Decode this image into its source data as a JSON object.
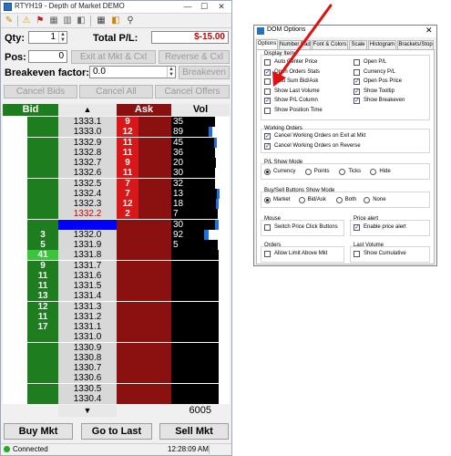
{
  "window": {
    "title": "RTYH19 - Depth of Market DEMO",
    "minimize": "—",
    "maximize": "☐",
    "close": "✕"
  },
  "toolbar": {
    "icons": [
      "pencil-icon",
      "warning-icon",
      "flag-icon",
      "ruler-icon",
      "grid-icon",
      "palette-icon",
      "pin-icon"
    ],
    "glyphs": [
      "✎",
      "⚠",
      "⚑",
      "▦",
      "▥",
      "◧",
      "⚲"
    ]
  },
  "controls": {
    "qty_label": "Qty:",
    "qty_value": "1",
    "pl_label": "Total P/L:",
    "pl_value": "$-15.00",
    "pos_label": "Pos:",
    "pos_value": "0",
    "exit_button": "Exit at Mkt & Cxl",
    "reverse_button": "Reverse & Cxl",
    "breakeven_factor_label": "Breakeven factor:",
    "breakeven_factor_value": "0.0",
    "breakeven_button": "Breakeven",
    "cancel_bids": "Cancel Bids",
    "cancel_all": "Cancel All",
    "cancel_offers": "Cancel Offers"
  },
  "ladder": {
    "headers": {
      "bid": "Bid",
      "price_arrow": "▲",
      "ask": "Ask",
      "vol": "Vol"
    },
    "footer": {
      "price_arrow": "▼",
      "total_vol": "6005"
    },
    "rows": [
      {
        "price": "1333.1",
        "bid": "",
        "ask": "9",
        "vol": "35",
        "volpct": 0.92,
        "blue": 0
      },
      {
        "price": "1333.0",
        "bid": "",
        "ask": "12",
        "vol": "89",
        "volpct": 0.78,
        "blue": 0.06
      },
      {
        "price": "1332.9",
        "bid": "",
        "ask": "11",
        "vol": "45",
        "volpct": 0.9,
        "blue": 0.03
      },
      {
        "price": "1332.8",
        "bid": "",
        "ask": "11",
        "vol": "36",
        "volpct": 0.92,
        "blue": 0
      },
      {
        "price": "1332.7",
        "bid": "",
        "ask": "9",
        "vol": "20",
        "volpct": 0.94,
        "blue": 0
      },
      {
        "price": "1332.6",
        "bid": "",
        "ask": "11",
        "vol": "30",
        "volpct": 0.92,
        "blue": 0
      },
      {
        "price": "1332.5",
        "bid": "",
        "ask": "7",
        "vol": "32",
        "volpct": 0.92,
        "blue": 0
      },
      {
        "price": "1332.4",
        "bid": "",
        "ask": "7",
        "vol": "13",
        "volpct": 0.96,
        "blue": 0.04
      },
      {
        "price": "1332.3",
        "bid": "",
        "ask": "12",
        "vol": "18",
        "volpct": 0.95,
        "blue": 0.04
      },
      {
        "price": "1332.2",
        "bid": "",
        "ask": "2",
        "vol": "7",
        "volpct": 0.98,
        "blue": 0,
        "red_price": true
      },
      {
        "price": "",
        "bid": "",
        "ask": "",
        "vol": "30",
        "volpct": 0.93,
        "blue": 0.06,
        "current": true
      },
      {
        "price": "1332.0",
        "bid": "3",
        "ask": "",
        "vol": "92",
        "volpct": 0.7,
        "blue": 0.08
      },
      {
        "price": "1331.9",
        "bid": "5",
        "ask": "",
        "vol": "5",
        "volpct": 0.99,
        "blue": 0
      },
      {
        "price": "1331.8",
        "bid": "41",
        "ask": "",
        "vol": "",
        "volpct": 1,
        "blue": 0,
        "bid_hi": true
      },
      {
        "price": "1331.7",
        "bid": "9",
        "ask": "",
        "vol": "",
        "volpct": 1,
        "blue": 0
      },
      {
        "price": "1331.6",
        "bid": "11",
        "ask": "",
        "vol": "",
        "volpct": 1,
        "blue": 0
      },
      {
        "price": "1331.5",
        "bid": "11",
        "ask": "",
        "vol": "",
        "volpct": 1,
        "blue": 0
      },
      {
        "price": "1331.4",
        "bid": "13",
        "ask": "",
        "vol": "",
        "volpct": 1,
        "blue": 0
      },
      {
        "price": "1331.3",
        "bid": "12",
        "ask": "",
        "vol": "",
        "volpct": 1,
        "blue": 0
      },
      {
        "price": "1331.2",
        "bid": "11",
        "ask": "",
        "vol": "",
        "volpct": 1,
        "blue": 0
      },
      {
        "price": "1331.1",
        "bid": "17",
        "ask": "",
        "vol": "",
        "volpct": 1,
        "blue": 0
      },
      {
        "price": "1331.0",
        "bid": "",
        "ask": "",
        "vol": "",
        "volpct": 1,
        "blue": 0
      },
      {
        "price": "1330.9",
        "bid": "",
        "ask": "",
        "vol": "",
        "volpct": 1,
        "blue": 0
      },
      {
        "price": "1330.8",
        "bid": "",
        "ask": "",
        "vol": "",
        "volpct": 1,
        "blue": 0
      },
      {
        "price": "1330.7",
        "bid": "",
        "ask": "",
        "vol": "",
        "volpct": 1,
        "blue": 0
      },
      {
        "price": "1330.6",
        "bid": "",
        "ask": "",
        "vol": "",
        "volpct": 1,
        "blue": 0
      },
      {
        "price": "1330.5",
        "bid": "",
        "ask": "",
        "vol": "",
        "volpct": 1,
        "blue": 0
      },
      {
        "price": "1330.4",
        "bid": "",
        "ask": "",
        "vol": "",
        "volpct": 1,
        "blue": 0
      }
    ]
  },
  "bottom_buttons": {
    "buy_mkt": "Buy Mkt",
    "go_to_last": "Go to Last",
    "sell_mkt": "Sell Mkt"
  },
  "status": {
    "text": "Connected",
    "time": "12:28:09 AM"
  },
  "colors": {
    "bid_dark": "#1e7d1e",
    "bid_light": "#3cc43c",
    "ask_dark": "#8b1010",
    "ask_cell": "#d81818",
    "price_bg": "#d8d8d8",
    "vol_bar": "#000000",
    "vol_blue": "#1e6fe0",
    "current_bar": "#0000ff",
    "pl_negative": "#cc0000",
    "arrow": "#e01010"
  },
  "options": {
    "title": "DOM Options",
    "tabs": [
      "Options",
      "Number Pad",
      "Font & Colors",
      "Scale",
      "Histogram",
      "Brackets/Stop"
    ],
    "display_items_title": "Display Items",
    "display_items": [
      {
        "label": "Auto Center Price",
        "checked": false
      },
      {
        "label": "Open Orders Stats",
        "checked": true
      },
      {
        "label": "Auto Sum Bid/Ask",
        "checked": false
      },
      {
        "label": "Show Last Volume",
        "checked": false
      },
      {
        "label": "Show P/L Column",
        "checked": true
      },
      {
        "label": "Show Position Time",
        "checked": false
      },
      {
        "label": "Open P/L",
        "checked": false
      },
      {
        "label": "Currency P/L",
        "checked": false
      },
      {
        "label": "Open Pos Price",
        "checked": true
      },
      {
        "label": "Show Tooltip",
        "checked": true
      },
      {
        "label": "Show Breakeven",
        "checked": true
      }
    ],
    "working_orders_title": "Working Orders",
    "working_orders": [
      {
        "label": "Cancel Working Orders on Exit at Mkt",
        "checked": true
      },
      {
        "label": "Cancel Working Orders on Reverse",
        "checked": true
      }
    ],
    "pl_show_mode_title": "P/L Show Mode",
    "pl_show_mode": [
      {
        "label": "Currency",
        "selected": true
      },
      {
        "label": "Points",
        "selected": false
      },
      {
        "label": "Ticks",
        "selected": false
      },
      {
        "label": "Hide",
        "selected": false
      }
    ],
    "buysell_title": "Buy/Sell Buttons Show Mode",
    "buysell_mode": [
      {
        "label": "Market",
        "selected": true
      },
      {
        "label": "Bid/Ask",
        "selected": false
      },
      {
        "label": "Both",
        "selected": false
      },
      {
        "label": "None",
        "selected": false
      }
    ],
    "mouse_title": "Mouse",
    "mouse_option": {
      "label": "Switch Price Click Buttons",
      "checked": false
    },
    "price_alert_title": "Price alert",
    "price_alert_option": {
      "label": "Enable price alert",
      "checked": true
    },
    "orders_title": "Orders",
    "orders_option": {
      "label": "Allow Limit Above Mkt",
      "checked": false
    },
    "last_volume_title": "Last Volume",
    "last_volume_option": {
      "label": "Show Cumulative",
      "checked": false
    }
  }
}
